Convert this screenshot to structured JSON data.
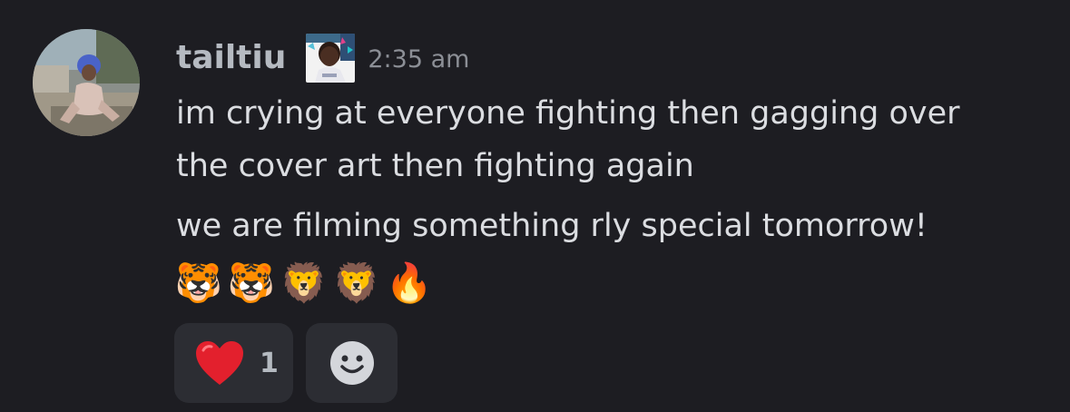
{
  "message": {
    "author": {
      "username": "tailtiu",
      "timestamp": "2:35 am",
      "avatar_icon": "user-avatar-photo",
      "badge_icon": "role-badge-image"
    },
    "lines": [
      "im crying at everyone fighting then gagging over",
      "the cover art then fighting again",
      "we are filming something rly special tomorrow!"
    ],
    "emojis": [
      "🐯",
      "🐯",
      "🦁",
      "🦁",
      "🔥"
    ],
    "reactions": [
      {
        "emoji": "❤️",
        "count": "1"
      }
    ],
    "add_reaction_icon": "smiley-face-icon"
  },
  "colors": {
    "background": "#1d1d22",
    "username": "#b5bac1",
    "timestamp": "#8c8f96",
    "message_text": "#dbdde1",
    "reaction_bg": "#2c2d33"
  }
}
